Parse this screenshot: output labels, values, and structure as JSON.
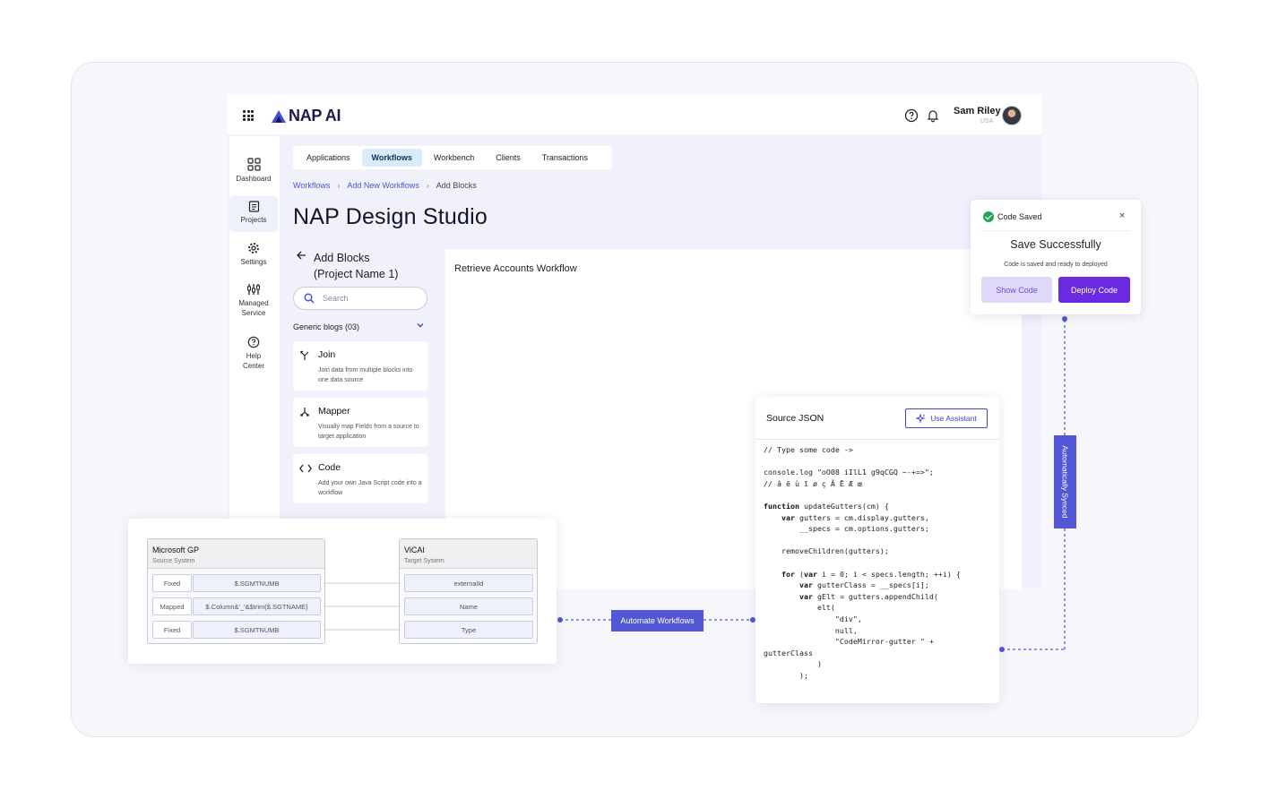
{
  "header": {
    "brand": "NAP AI",
    "user_name": "Sam Riley",
    "user_location": "USA",
    "icons": [
      "apps-grid-icon",
      "help-icon",
      "bell-icon"
    ]
  },
  "sidebar": {
    "items": [
      {
        "label": "Dashboard",
        "icon": "dashboard-icon"
      },
      {
        "label": "Projects",
        "icon": "document-icon"
      },
      {
        "label": "Settings",
        "icon": "gear-icon"
      },
      {
        "label": "Managed",
        "label2": "Service",
        "icon": "sliders-icon"
      },
      {
        "label": "Help",
        "label2": "Center",
        "icon": "help-icon"
      }
    ]
  },
  "tabs": [
    "Applications",
    "Workflows",
    "Workbench",
    "Clients",
    "Transactions"
  ],
  "active_tab": "Workflows",
  "breadcrumb": [
    "Workflows",
    "Add New Workflows",
    "Add Blocks"
  ],
  "page_title": "NAP Design Studio",
  "blocks": {
    "title_line1": "Add Blocks",
    "title_line2": "(Project Name 1)",
    "search_placeholder": "Search",
    "group_label": "Generic blogs (03)",
    "cards": [
      {
        "title": "Join",
        "desc": "Join data from multiple blocks into one data source"
      },
      {
        "title": "Mapper",
        "desc": "Visually map Fields from a source to target application"
      },
      {
        "title": "Code",
        "desc": "Add your own Java Script code into a workflow"
      }
    ]
  },
  "canvas": {
    "title": "Retrieve Accounts Workflow"
  },
  "toast": {
    "status": "Code Saved",
    "heading": "Save Successfully",
    "message": "Code is saved and ready to deployed",
    "show_label": "Show Code",
    "deploy_label": "Deploy Code",
    "close_symbol": "×"
  },
  "sync_label": "Automatically Synced",
  "automate_label": "Automate Workflows",
  "json_panel": {
    "title": "Source JSON",
    "assist_label": "Use Assistant"
  },
  "mapper": {
    "source": {
      "name": "Microsoft GP",
      "sub": "Source System"
    },
    "target": {
      "name": "ViCAI",
      "sub": "Target System"
    },
    "rows": [
      {
        "kind": "Fixed",
        "value": "$.SGMTNUMB",
        "target": "externalId"
      },
      {
        "kind": "Mapped",
        "value": "$.Column&'_'&$trim($.SGTNAME)",
        "target": "Name"
      },
      {
        "kind": "Fixed",
        "value": "$.SGMTNUMB",
        "target": "Type"
      }
    ]
  },
  "colors": {
    "accent": "#5257d6",
    "deploy": "#6a2be0",
    "success": "#22a55a",
    "link": "#4256d8"
  }
}
